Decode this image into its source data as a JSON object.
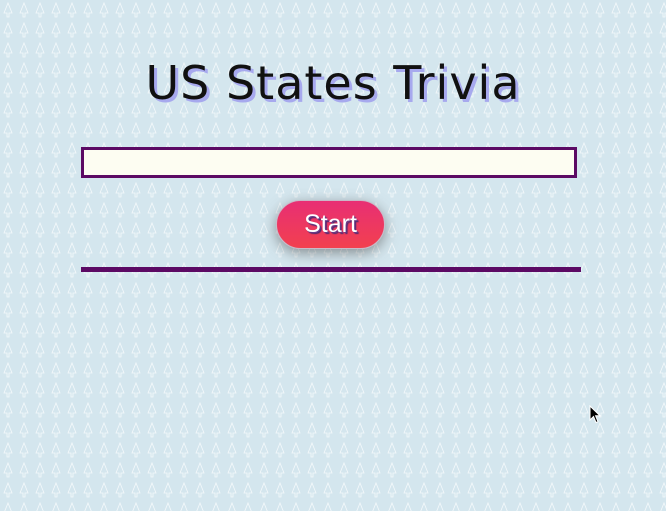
{
  "page": {
    "title": "US States Trivia"
  },
  "quiz": {
    "answer_value": "",
    "answer_placeholder": "",
    "start_label": "Start"
  },
  "colors": {
    "background": "#d4e6ee",
    "accent_purple": "#5c0a64",
    "button_gradient_top": "#e82f74",
    "button_gradient_bottom": "#f2404f",
    "input_background": "#fdfdf2"
  },
  "icons": {
    "cursor": "mouse-pointer-icon",
    "background_pattern": "tree-outline-icon"
  }
}
